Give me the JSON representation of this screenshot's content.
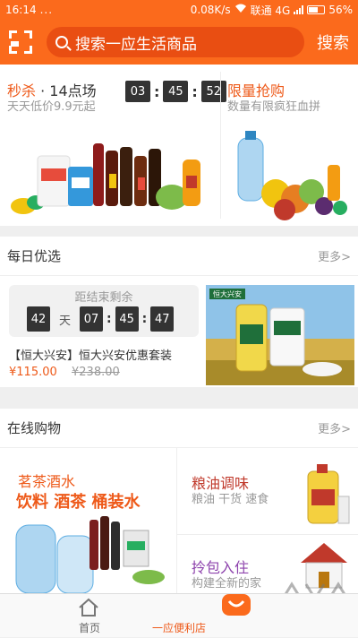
{
  "status_bar": {
    "time": "16:14",
    "dots": "...",
    "speed": "0.08K/s",
    "carrier": "联通 4G",
    "battery": "56%"
  },
  "header": {
    "search_placeholder": "搜索一应生活商品",
    "search_button": "搜索"
  },
  "flash_sale": {
    "title": "秒杀",
    "session": "· 14点场",
    "subtitle": "天天低价9.9元起",
    "hours": "03",
    "minutes": "45",
    "seconds": "52",
    "limited_title": "限量抢购",
    "limited_subtitle": "数量有限疯狂血拼"
  },
  "daily": {
    "title": "每日优选",
    "more": "更多>",
    "countdown_label": "距结束剩余",
    "days": "42",
    "days_unit": "天",
    "hours": "07",
    "minutes": "45",
    "seconds": "47",
    "product_name": "【恒大兴安】恒大兴安优惠套装",
    "price": "¥115.00",
    "old_price": "¥238.00",
    "banner_brand": "恒大兴安"
  },
  "online": {
    "title": "在线购物",
    "more": "更多>",
    "drinks_title": "茗茶酒水",
    "drinks_subtitle": "饮料 酒茶 桶装水",
    "oil_title": "粮油调味",
    "oil_subtitle": "粮油 干货 速食",
    "bag_title": "拎包入住",
    "bag_subtitle": "构建全新的家"
  },
  "tabbar": {
    "home": "首页",
    "store": "一应便利店"
  },
  "colors": {
    "brand": "#fb6a1c",
    "accent": "#ee5a1a"
  }
}
